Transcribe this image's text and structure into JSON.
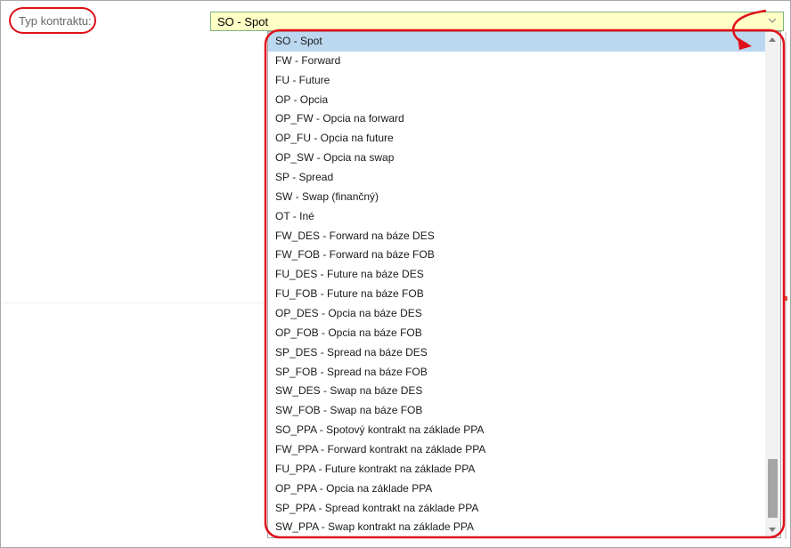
{
  "form": {
    "label": "Typ kontraktu:",
    "selected_value": "SO - Spot"
  },
  "icons": {
    "select_arrow": "chevron-down-icon",
    "scroll_up": "scroll-up-arrow-icon",
    "scroll_down": "scroll-down-arrow-icon"
  },
  "colors": {
    "select_background": "#ffffc6",
    "selected_option": "#bcd7f0",
    "annotation": "#e0101a"
  },
  "dropdown": {
    "selected_index": 0,
    "options": [
      "SO - Spot",
      "FW - Forward",
      "FU - Future",
      "OP - Opcia",
      "OP_FW - Opcia na forward",
      "OP_FU - Opcia na future",
      "OP_SW - Opcia na swap",
      "SP - Spread",
      "SW - Swap (finančný)",
      "OT - Iné",
      "FW_DES - Forward na báze DES",
      "FW_FOB - Forward na báze FOB",
      "FU_DES - Future na báze DES",
      "FU_FOB - Future na báze FOB",
      "OP_DES - Opcia na báze DES",
      "OP_FOB - Opcia na báze FOB",
      "SP_DES - Spread na báze DES",
      "SP_FOB - Spread na báze FOB",
      "SW_DES - Swap na báze DES",
      "SW_FOB - Swap na báze FOB",
      "SO_PPA - Spotový kontrakt na základe PPA",
      "FW_PPA - Forward kontrakt na základe PPA",
      "FU_PPA - Future kontrakt na základe PPA",
      "OP_PPA - Opcia na základe PPA",
      "SP_PPA - Spread kontrakt na základe PPA",
      "SW_PPA - Swap kontrakt na základe PPA"
    ]
  }
}
